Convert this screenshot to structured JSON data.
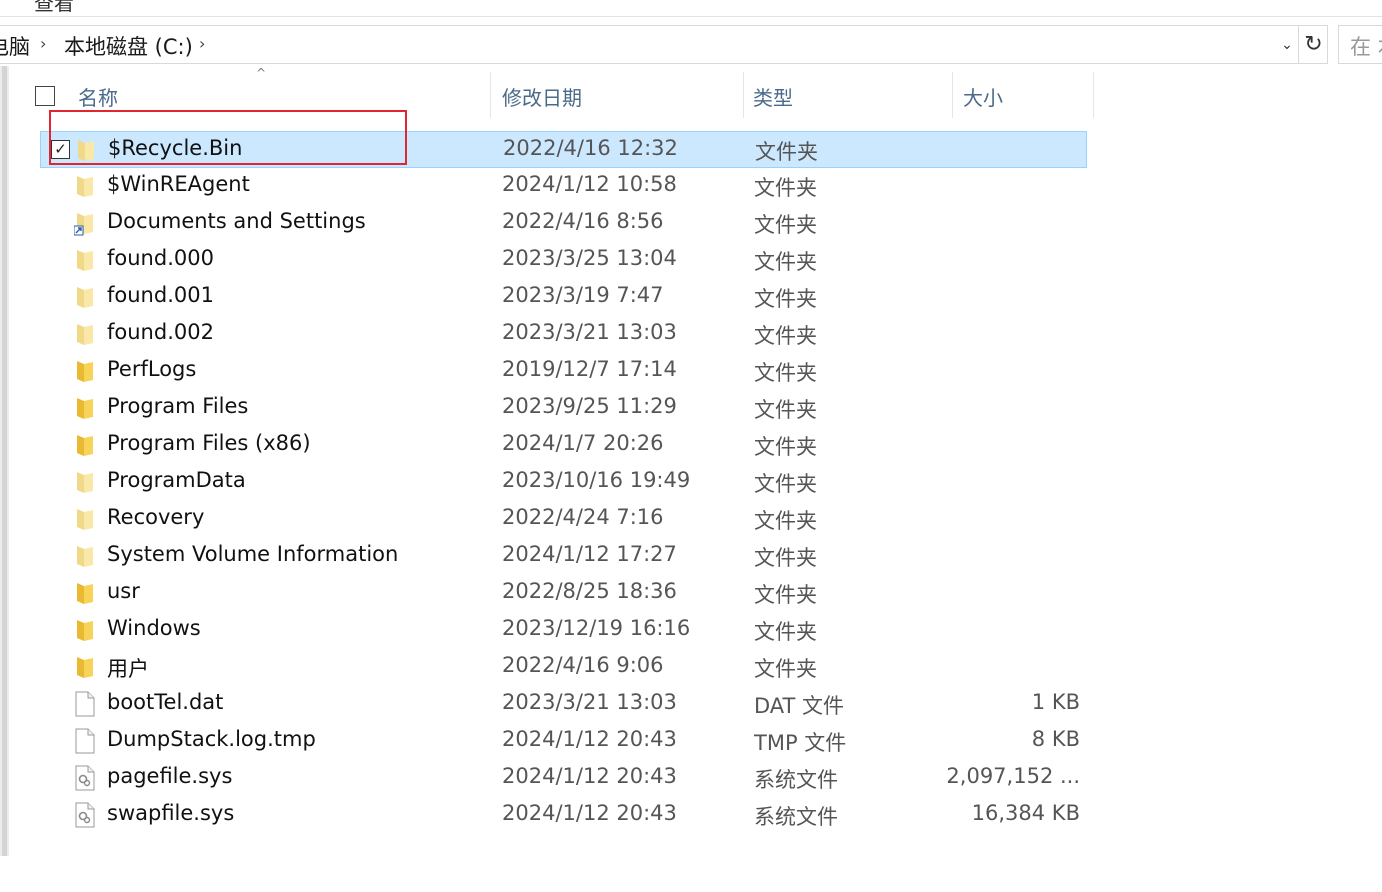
{
  "ribbon": {
    "tab_label": "查看"
  },
  "address_bar": {
    "crumbs": [
      "电脑",
      "本地磁盘 (C:)"
    ],
    "separator": "›",
    "dropdown_glyph": "⌄",
    "refresh_glyph": "↻",
    "search_placeholder": "在 本"
  },
  "columns": {
    "name": "名称",
    "modified": "修改日期",
    "type": "类型",
    "size": "大小",
    "sort_glyph": "^"
  },
  "icons": {
    "folder": "folder-icon",
    "shortcut_folder": "folder-shortcut-icon",
    "file": "blank-file-icon",
    "system_file": "system-file-icon"
  },
  "colors": {
    "selection_bg": "#cce8ff",
    "selection_border": "#99d1ff",
    "folder_yellow": "#f7d358",
    "annotation_red": "#e0262f",
    "header_text": "#4a6a8a"
  },
  "files": [
    {
      "name": "$Recycle.Bin",
      "modified": "2022/4/16 12:32",
      "type": "文件夹",
      "size": "",
      "icon": "folder-faded",
      "selected": true,
      "checkbox": "✓"
    },
    {
      "name": "$WinREAgent",
      "modified": "2024/1/12 10:58",
      "type": "文件夹",
      "size": "",
      "icon": "folder-faded",
      "selected": false
    },
    {
      "name": "Documents and Settings",
      "modified": "2022/4/16 8:56",
      "type": "文件夹",
      "size": "",
      "icon": "shortcut",
      "selected": false
    },
    {
      "name": "found.000",
      "modified": "2023/3/25 13:04",
      "type": "文件夹",
      "size": "",
      "icon": "folder-faded",
      "selected": false
    },
    {
      "name": "found.001",
      "modified": "2023/3/19 7:47",
      "type": "文件夹",
      "size": "",
      "icon": "folder-faded",
      "selected": false
    },
    {
      "name": "found.002",
      "modified": "2023/3/21 13:03",
      "type": "文件夹",
      "size": "",
      "icon": "folder-faded",
      "selected": false
    },
    {
      "name": "PerfLogs",
      "modified": "2019/12/7 17:14",
      "type": "文件夹",
      "size": "",
      "icon": "folder",
      "selected": false
    },
    {
      "name": "Program Files",
      "modified": "2023/9/25 11:29",
      "type": "文件夹",
      "size": "",
      "icon": "folder",
      "selected": false
    },
    {
      "name": "Program Files (x86)",
      "modified": "2024/1/7 20:26",
      "type": "文件夹",
      "size": "",
      "icon": "folder",
      "selected": false
    },
    {
      "name": "ProgramData",
      "modified": "2023/10/16 19:49",
      "type": "文件夹",
      "size": "",
      "icon": "folder-faded",
      "selected": false
    },
    {
      "name": "Recovery",
      "modified": "2022/4/24 7:16",
      "type": "文件夹",
      "size": "",
      "icon": "folder-faded",
      "selected": false
    },
    {
      "name": "System Volume Information",
      "modified": "2024/1/12 17:27",
      "type": "文件夹",
      "size": "",
      "icon": "folder-faded",
      "selected": false
    },
    {
      "name": "usr",
      "modified": "2022/8/25 18:36",
      "type": "文件夹",
      "size": "",
      "icon": "folder",
      "selected": false
    },
    {
      "name": "Windows",
      "modified": "2023/12/19 16:16",
      "type": "文件夹",
      "size": "",
      "icon": "folder",
      "selected": false
    },
    {
      "name": "用户",
      "modified": "2022/4/16 9:06",
      "type": "文件夹",
      "size": "",
      "icon": "folder",
      "selected": false
    },
    {
      "name": "bootTel.dat",
      "modified": "2023/3/21 13:03",
      "type": "DAT 文件",
      "size": "1 KB",
      "icon": "file",
      "selected": false
    },
    {
      "name": "DumpStack.log.tmp",
      "modified": "2024/1/12 20:43",
      "type": "TMP 文件",
      "size": "8 KB",
      "icon": "file",
      "selected": false
    },
    {
      "name": "pagefile.sys",
      "modified": "2024/1/12 20:43",
      "type": "系统文件",
      "size": "2,097,152 ...",
      "icon": "system",
      "selected": false
    },
    {
      "name": "swapfile.sys",
      "modified": "2024/1/12 20:43",
      "type": "系统文件",
      "size": "16,384 KB",
      "icon": "system",
      "selected": false
    }
  ]
}
